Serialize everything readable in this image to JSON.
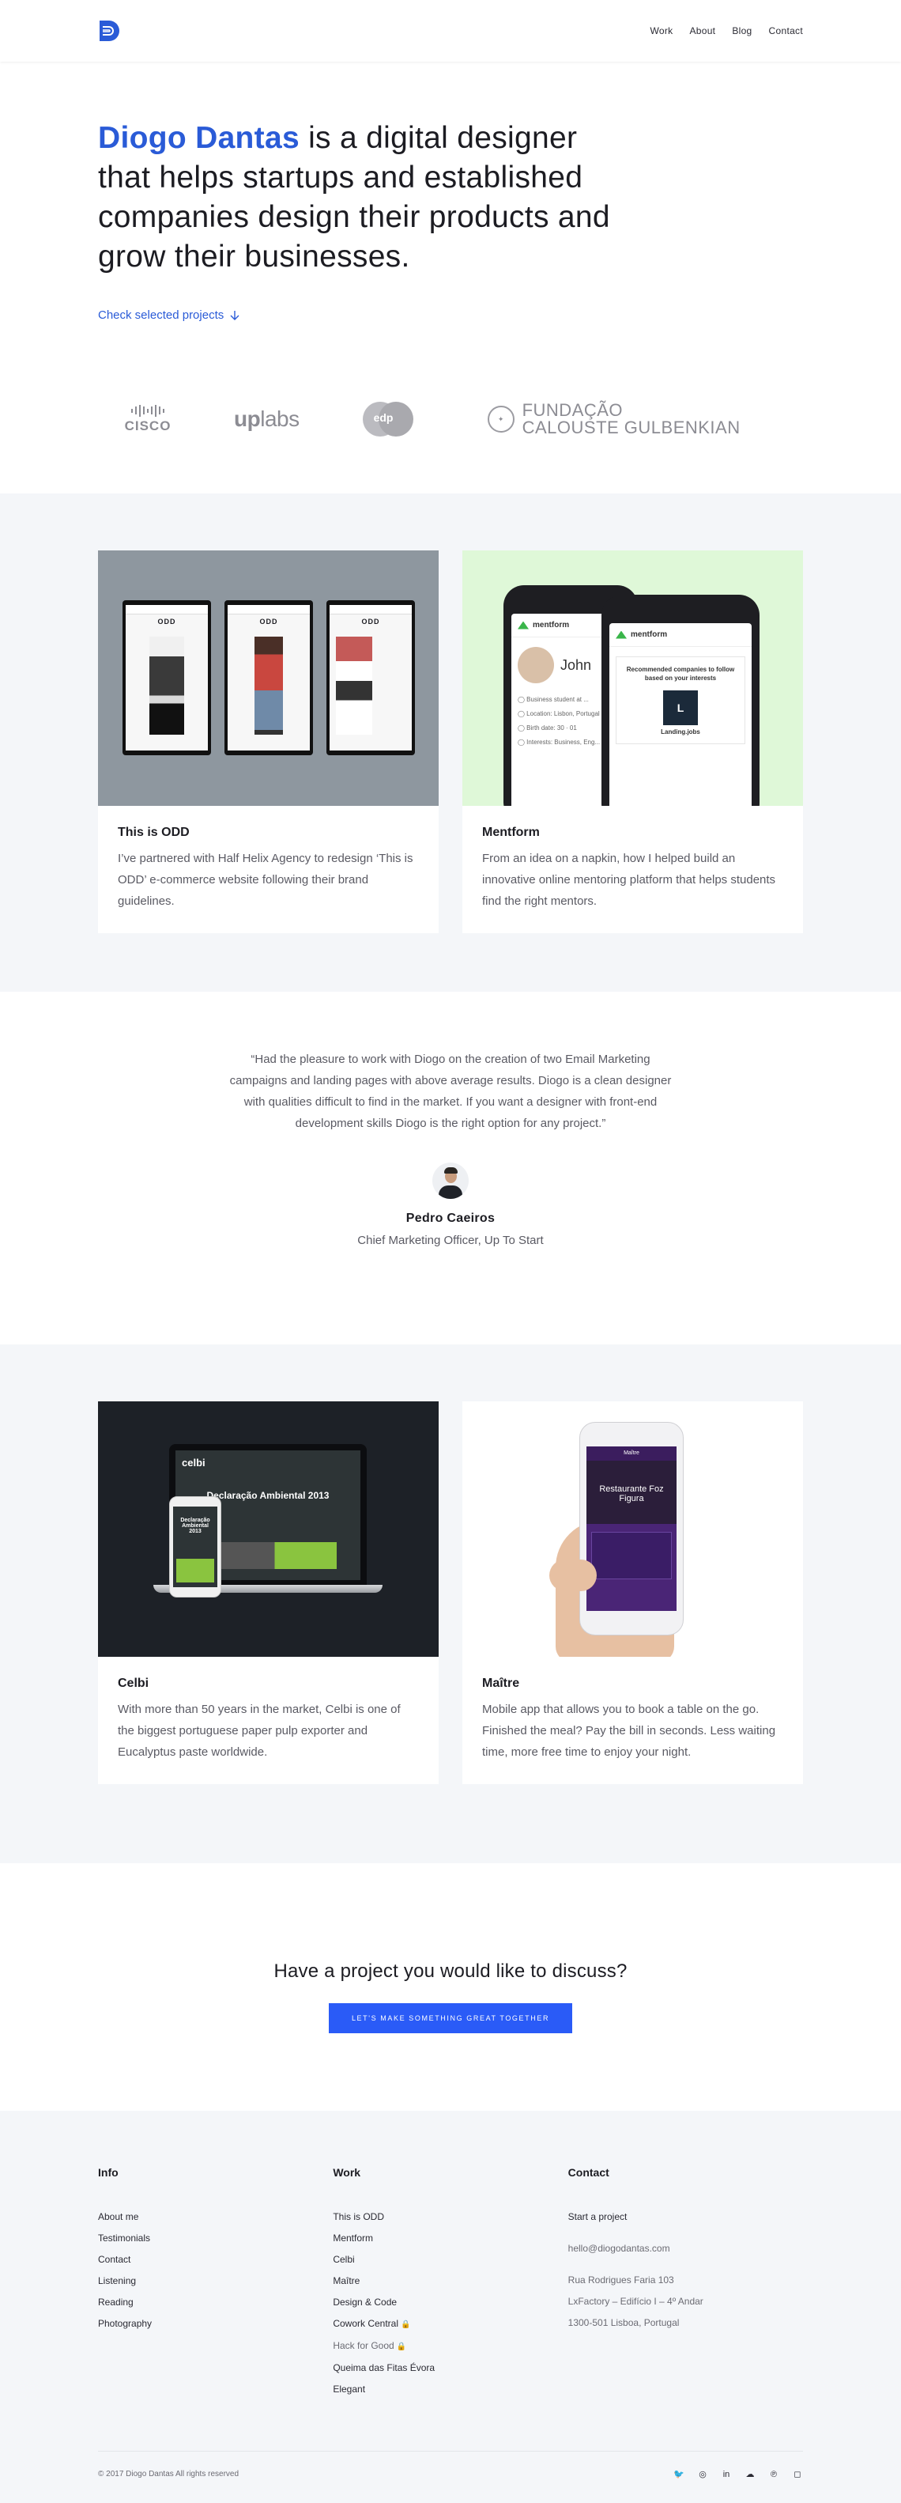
{
  "nav": {
    "items": [
      {
        "label": "Work"
      },
      {
        "label": "About"
      },
      {
        "label": "Blog"
      },
      {
        "label": "Contact"
      }
    ]
  },
  "hero": {
    "name": "Diogo Dantas",
    "headline_rest": " is a digital designer that helps startups and established companies design their products and grow their businesses.",
    "cta_label": "Check selected projects"
  },
  "clients": {
    "cisco": "CISCO",
    "uplabs_a": "up",
    "uplabs_b": "labs",
    "edp": "edp",
    "gulbenkian_1": "FUNDAÇÃO",
    "gulbenkian_2": "CALOUSTE GULBENKIAN"
  },
  "projects": [
    {
      "title": "This is ODD",
      "description": "I’ve partnered with Half Helix Agency to redesign ‘This is ODD’ e-commerce website following their brand guidelines.",
      "screen_logo": "ODD"
    },
    {
      "title": "Mentform",
      "description": "From an idea on a napkin, how I helped build an innovative online mentoring platform that helps students find the right mentors.",
      "screen_brand": "mentform",
      "screen_name": "John",
      "screen_modal": "Recommended companies to follow based on your interests",
      "screen_company": "Landing.jobs"
    },
    {
      "title": "Celbi",
      "description": "With more than 50 years in the market, Celbi is one of the biggest portuguese paper pulp exporter and Eucalyptus paste worldwide.",
      "screen_brand": "celbi",
      "screen_heading": "Declaração Ambiental 2013"
    },
    {
      "title": "Maître",
      "description": "Mobile app that allows you to book a table on the go. Finished the meal? Pay the bill in seconds. Less waiting time, more free time to enjoy your night.",
      "screen_brand": "Maître",
      "screen_heading": "Restaurante Foz Figura"
    }
  ],
  "testimonial": {
    "quote": "“Had the pleasure to work with Diogo on the creation of two Email Marketing campaigns and landing pages with above average results. Diogo is a clean designer with qualities difficult to find in the market. If you want a designer with front-end development skills Diogo is the right option for any project.”",
    "name": "Pedro Caeiros",
    "role": "Chief Marketing Officer, Up To Start"
  },
  "cta": {
    "heading": "Have a project you would like to discuss?",
    "button": "LET'S MAKE SOMETHING GREAT TOGETHER"
  },
  "footer": {
    "info_title": "Info",
    "info_links": [
      "About me",
      "Testimonials",
      "Contact",
      "Listening",
      "Reading",
      "Photography"
    ],
    "work_title": "Work",
    "work_links": [
      "This is ODD",
      "Mentform",
      "Celbi",
      "Maître",
      "Design & Code",
      "Cowork Central",
      "Hack for Good",
      "Queima das  Fitas Évora",
      "Elegant"
    ],
    "contact_title": "Contact",
    "contact_cta": "Start a project",
    "email": "hello@diogodantas.com",
    "address_1": "Rua Rodrigues Faria 103",
    "address_2": "LxFactory – Edifício I – 4º Andar",
    "address_3": "1300-501 Lisboa, Portugal",
    "copyright": "© 2017 Diogo Dantas All rights reserved",
    "socials": [
      "twitter-icon",
      "dribbble-icon",
      "linkedin-icon",
      "soundcloud-icon",
      "pinterest-icon",
      "instagram-icon"
    ]
  },
  "colors": {
    "accent": "#2a5bd7",
    "button": "#2a5bf7",
    "section_bg": "#f4f6f9"
  }
}
